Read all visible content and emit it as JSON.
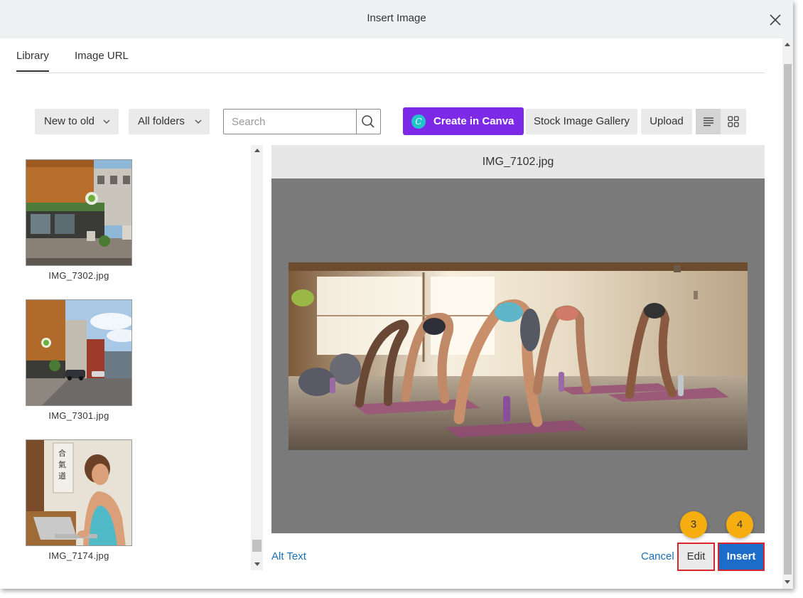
{
  "dialog": {
    "title": "Insert Image",
    "close_icon": "close-icon"
  },
  "tabs": [
    {
      "label": "Library",
      "active": true
    },
    {
      "label": "Image URL",
      "active": false
    }
  ],
  "toolbar": {
    "sort_label": "New to old",
    "folder_label": "All folders",
    "search_placeholder": "Search",
    "search_value": "",
    "canva_label": "Create in Canva",
    "stock_label": "Stock Image Gallery",
    "upload_label": "Upload",
    "view_modes": [
      "list-view-icon",
      "grid-view-icon"
    ],
    "active_view": "list"
  },
  "images": [
    {
      "name": "IMG_7302.jpg"
    },
    {
      "name": "IMG_7301.jpg"
    },
    {
      "name": "IMG_7174.jpg"
    }
  ],
  "preview": {
    "filename": "IMG_7102.jpg"
  },
  "footer": {
    "alt_text_label": "Alt Text",
    "cancel_label": "Cancel",
    "edit_label": "Edit",
    "insert_label": "Insert"
  },
  "callouts": [
    {
      "number": "3",
      "target": "edit"
    },
    {
      "number": "4",
      "target": "insert"
    }
  ],
  "colors": {
    "canva_purple": "#7d2ae8",
    "insert_blue": "#1c6dc9",
    "link_blue": "#1a6fb5",
    "highlight_red": "#d9262c",
    "callout_orange": "#f5ad0f"
  }
}
